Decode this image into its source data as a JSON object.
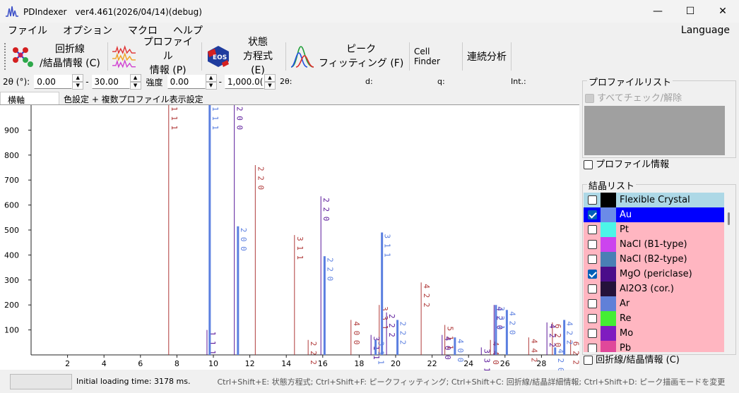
{
  "window": {
    "title": "PDIndexer　ver4.461(2026/04/14)(debug)",
    "minimize": "—",
    "maximize": "☐",
    "close": "✕"
  },
  "menu": {
    "items": [
      "ファイル",
      "オプション",
      "マクロ",
      "ヘルプ"
    ],
    "language": "Language"
  },
  "toolbar": {
    "diffraction": [
      "回折線",
      "/結晶情報 (C)"
    ],
    "profile": [
      "プロファイル",
      "情報 (P)"
    ],
    "eos": [
      "状態",
      "方程式 (E)"
    ],
    "peak": [
      "ピーク",
      "フィッティング (F)"
    ],
    "cellfinder": "Cell Finder",
    "sequential": "連続分析"
  },
  "params": {
    "twotheta_label": "2θ (°):",
    "twotheta_min": "0.00",
    "dash1": "-",
    "twotheta_max": "30.00",
    "intensity_label": "強度",
    "intensity_min": "0.00",
    "dash2": "-",
    "intensity_max": "1,000.0(",
    "h_2theta": "2θ:",
    "h_d": "d:",
    "h_q": "q:",
    "h_int": "Int.:"
  },
  "tabs": {
    "horizontal_axis": "横軸",
    "color_settings": "色設定 + 複数プロファイル表示設定"
  },
  "chart_data": {
    "type": "bar",
    "xlim": [
      0,
      30
    ],
    "ylim": [
      0,
      1000
    ],
    "x_ticks": [
      2,
      4,
      6,
      8,
      10,
      12,
      14,
      16,
      18,
      20,
      22,
      24,
      26,
      28
    ],
    "y_ticks": [
      100,
      200,
      300,
      400,
      500,
      600,
      700,
      800,
      900
    ],
    "grid": false,
    "series": [
      {
        "name": "Pt",
        "color": "#b03a3a",
        "width": 1,
        "peaks": [
          {
            "x": 7.55,
            "y": 1000,
            "label": "1 1 1"
          },
          {
            "x": 12.3,
            "y": 760,
            "label": "2 2 0"
          },
          {
            "x": 14.45,
            "y": 480,
            "label": "3 1 1"
          },
          {
            "x": 15.2,
            "y": 60,
            "label": "2 2 2"
          },
          {
            "x": 17.55,
            "y": 140,
            "label": "4 0 0"
          },
          {
            "x": 19.1,
            "y": 200,
            "label": "3 3 1"
          },
          {
            "x": 21.4,
            "y": 290,
            "label": "4 2 2"
          },
          {
            "x": 22.7,
            "y": 120,
            "label": "5 1 1"
          },
          {
            "x": 25.2,
            "y": 60,
            "label": "4 4 0"
          },
          {
            "x": 27.3,
            "y": 70,
            "label": "4 4 2"
          },
          {
            "x": 28.6,
            "y": 130,
            "label": "6 2 0"
          },
          {
            "x": 29.6,
            "y": 60,
            "label": "6 2 2"
          }
        ]
      },
      {
        "name": "MgO (periclase)",
        "color": "#5a189a",
        "width": 1,
        "peaks": [
          {
            "x": 9.65,
            "y": 100,
            "label": "1 1 1"
          },
          {
            "x": 11.15,
            "y": 1000,
            "label": "2 0 0"
          },
          {
            "x": 15.9,
            "y": 635,
            "label": "2 2 0"
          },
          {
            "x": 18.65,
            "y": 80,
            "label": "3 1 1"
          },
          {
            "x": 19.5,
            "y": 170,
            "label": "2 2 2"
          },
          {
            "x": 22.55,
            "y": 80,
            "label": "4 0 0"
          },
          {
            "x": 24.7,
            "y": 30,
            "label": "3 3 1"
          },
          {
            "x": 25.4,
            "y": 200,
            "label": "4 2 0"
          },
          {
            "x": 28.3,
            "y": 130,
            "label": "4 2 2"
          }
        ]
      },
      {
        "name": "Au",
        "color": "#5b7fe0",
        "width": 3,
        "peaks": [
          {
            "x": 9.8,
            "y": 1000,
            "label": "1 1 1"
          },
          {
            "x": 11.35,
            "y": 515,
            "label": "2 0 0"
          },
          {
            "x": 16.1,
            "y": 395,
            "label": "2 2 0"
          },
          {
            "x": 18.9,
            "y": 60,
            "label": "3 1 1"
          },
          {
            "x": 19.25,
            "y": 490,
            "label": "3 1 1"
          },
          {
            "x": 20.1,
            "y": 140,
            "label": "2 2 2"
          },
          {
            "x": 23.25,
            "y": 70,
            "label": "4 0 0"
          },
          {
            "x": 25.5,
            "y": 200,
            "label": "3 3 1"
          },
          {
            "x": 26.1,
            "y": 180,
            "label": "4 2 0"
          },
          {
            "x": 28.75,
            "y": 30,
            "label": "4 2 0"
          },
          {
            "x": 29.25,
            "y": 140,
            "label": "4 2 2"
          }
        ]
      }
    ]
  },
  "profile_list": {
    "title": "プロファイルリスト",
    "check_all": "すべてチェック/解除",
    "profile_info": "プロファイル情報"
  },
  "crystal_list": {
    "title": "結晶リスト",
    "items": [
      {
        "name": "Flexible Crystal",
        "color": "#000000",
        "checked": false,
        "bg": "#add8e6"
      },
      {
        "name": "Au",
        "color": "#6b8be8",
        "checked": true,
        "bg": "#0000ff",
        "fg": "#ffffff"
      },
      {
        "name": "Pt",
        "color": "#4cf5e8",
        "checked": false,
        "bg": "#ffb6c1"
      },
      {
        "name": "NaCl (B1-type)",
        "color": "#cc44ee",
        "checked": false,
        "bg": "#ffb6c1"
      },
      {
        "name": "NaCl (B2-type)",
        "color": "#4a7fb5",
        "checked": false,
        "bg": "#ffb6c1"
      },
      {
        "name": "MgO (periclase)",
        "color": "#4b0d8a",
        "checked": true,
        "bg": "#ffb6c1"
      },
      {
        "name": "Al2O3 (cor.)",
        "color": "#25123a",
        "checked": false,
        "bg": "#ffb6c1"
      },
      {
        "name": "Ar",
        "color": "#6080d8",
        "checked": false,
        "bg": "#ffb6c1"
      },
      {
        "name": "Re",
        "color": "#44ee33",
        "checked": false,
        "bg": "#ffb6c1"
      },
      {
        "name": "Mo",
        "color": "#7f1cc0",
        "checked": false,
        "bg": "#ffb6c1"
      },
      {
        "name": "Pb",
        "color": "#e0489a",
        "checked": false,
        "bg": "#ffb6c1"
      }
    ],
    "diffraction_info": "回折線/結晶情報 (C)"
  },
  "status": {
    "loading": "Initial loading time: 3178 ms.",
    "shortcuts": "Ctrl+Shift+E: 状態方程式;  Ctrl+Shift+F: ピークフィッティング;  Ctrl+Shift+C: 回折線/結晶詳細情報;  Ctrl+Shift+D:  ピーク描画モードを変更"
  }
}
